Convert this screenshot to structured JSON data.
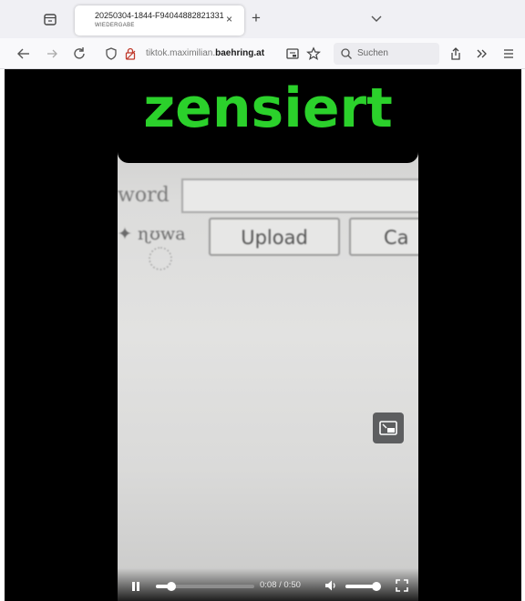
{
  "browser": {
    "tab": {
      "title": "20250304-1844-F94044882821331",
      "subtitle": "WIEDERGABE",
      "close_glyph": "×"
    },
    "new_tab_glyph": "+",
    "url": {
      "prefix": "tiktok.maximilian.",
      "host": "baehring.at",
      "suffix": ""
    },
    "search": {
      "placeholder": "Suchen"
    },
    "icons": [
      "tab-list-icon",
      "chevron-down-icon",
      "back-arrow-icon",
      "forward-arrow-icon",
      "reload-icon",
      "shield-icon",
      "lock-icon",
      "reader-view-icon",
      "star-icon",
      "search-icon",
      "share-icon",
      "overflow-chevrons-icon",
      "hamburger-menu-icon"
    ]
  },
  "video": {
    "overlay_text": "zensiert",
    "overlay_color": "#2bd12b",
    "filmed_page": {
      "password_label": "word",
      "file_label": "✦ ɳʊwa",
      "upload_label": "Upload",
      "cancel_label": "Ca"
    },
    "controls": {
      "current_time": "0:08",
      "separator": " / ",
      "duration": "0:50",
      "progress_fraction": 0.16,
      "volume_fraction": 0.9
    }
  }
}
